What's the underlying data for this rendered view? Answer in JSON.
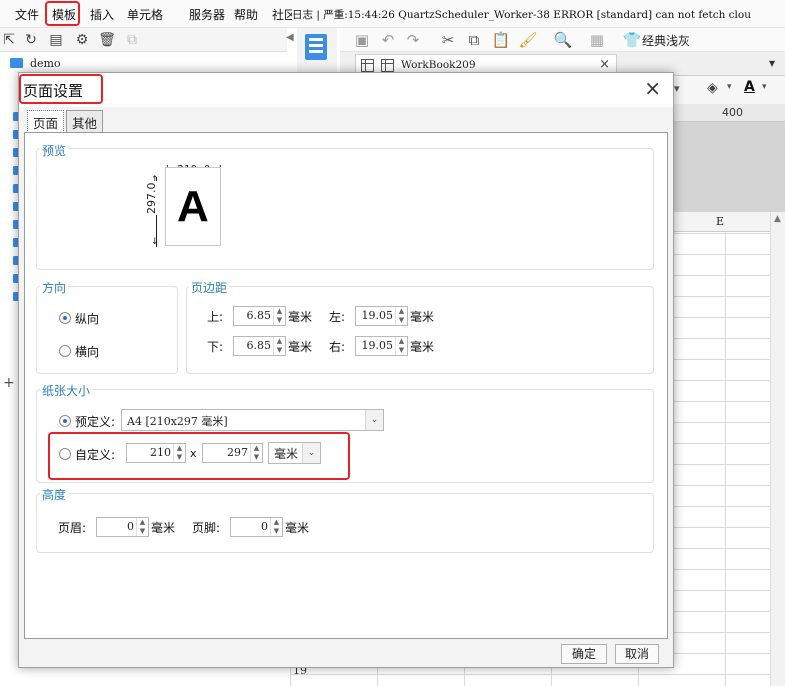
{
  "menubar": {
    "items": [
      "文件",
      "模板",
      "插入",
      "单元格",
      "服务器",
      "帮助",
      "社区"
    ],
    "log": "日志 | 严重:15:44:26 QuartzScheduler_Worker-38 ERROR [standard] can not fetch clou"
  },
  "left_panel": {
    "tree_root": "demo"
  },
  "right_toolbar": {
    "theme_label": "经典浅灰"
  },
  "workbook_tab": {
    "label": "WorkBook209",
    "close": "×"
  },
  "ruler": {
    "label": "400"
  },
  "sheet": {
    "column_e": "E",
    "row_19": "19"
  },
  "dialog": {
    "title": "页面设置",
    "close": "×",
    "tabs": [
      {
        "label": "页面",
        "active": true
      },
      {
        "label": "其他",
        "active": false
      }
    ],
    "preview": {
      "group_title": "预览",
      "width_label": "210.0",
      "height_label": "297.0",
      "letter": "A"
    },
    "orientation": {
      "group_title": "方向",
      "portrait": "纵向",
      "landscape": "横向",
      "selected": "portrait"
    },
    "margins": {
      "group_title": "页边距",
      "top_label": "上:",
      "top_value": "6.85",
      "bottom_label": "下:",
      "bottom_value": "6.85",
      "left_label": "左:",
      "left_value": "19.05",
      "right_label": "右:",
      "right_value": "19.05",
      "unit": "毫米"
    },
    "paper_size": {
      "group_title": "纸张大小",
      "predefined_label": "预定义:",
      "predefined_value": "A4 [210x297 毫米]",
      "custom_label": "自定义:",
      "custom_width": "210",
      "times": "x",
      "custom_height": "297",
      "unit_value": "毫米",
      "selected": "predefined"
    },
    "height": {
      "group_title": "高度",
      "header_label": "页眉:",
      "header_value": "0",
      "footer_label": "页脚:",
      "footer_value": "0",
      "unit": "毫米"
    },
    "buttons": {
      "ok": "确定",
      "cancel": "取消"
    }
  },
  "colors": {
    "highlight": "#e5222a",
    "accent_blue": "#2a7fc0",
    "icon_blue": "#3a8ee6"
  }
}
